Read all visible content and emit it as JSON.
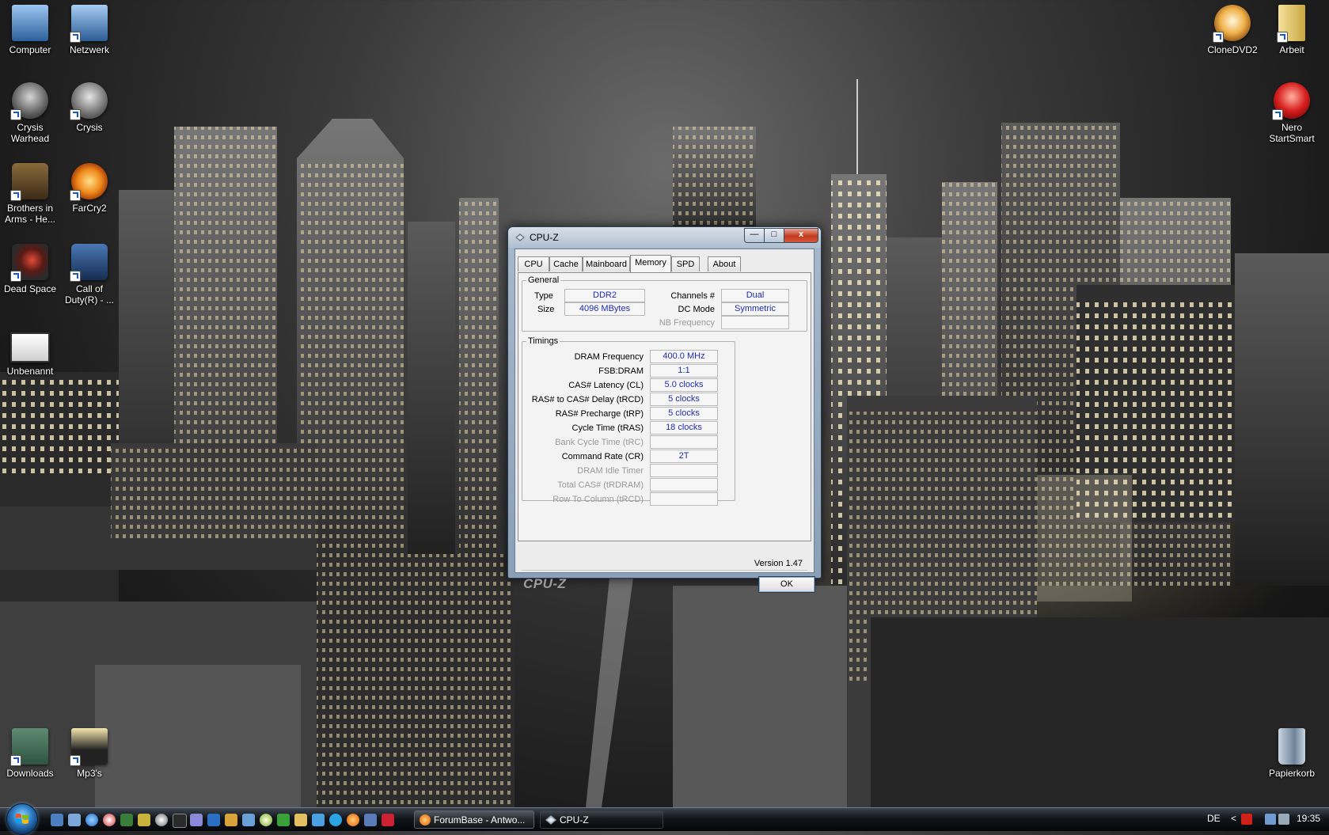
{
  "desktop": {
    "icons_left": [
      {
        "label": "Computer"
      },
      {
        "label": "Netzwerk"
      },
      {
        "label": "Crysis Warhead"
      },
      {
        "label": "Crysis"
      },
      {
        "label": "Brothers in Arms - He..."
      },
      {
        "label": "FarCry2"
      },
      {
        "label": "Dead Space"
      },
      {
        "label": "Call of Duty(R) - ..."
      },
      {
        "label": "Unbenannt"
      },
      {
        "label": "Downloads"
      },
      {
        "label": "Mp3's"
      }
    ],
    "icons_right": [
      {
        "label": "CloneDVD2"
      },
      {
        "label": "Arbeit"
      },
      {
        "label": "Nero StartSmart"
      },
      {
        "label": "Papierkorb"
      }
    ]
  },
  "window": {
    "title": "CPU-Z",
    "controls": {
      "minimize": "—",
      "maximize": "□",
      "close": "x"
    },
    "tabs": [
      {
        "label": "CPU",
        "active": false
      },
      {
        "label": "Cache",
        "active": false
      },
      {
        "label": "Mainboard",
        "active": false
      },
      {
        "label": "Memory",
        "active": true
      },
      {
        "label": "SPD",
        "active": false
      },
      {
        "label": "About",
        "active": false
      }
    ],
    "general": {
      "legend": "General",
      "type_label": "Type",
      "type_value": "DDR2",
      "size_label": "Size",
      "size_value": "4096 MBytes",
      "channels_label": "Channels #",
      "channels_value": "Dual",
      "dcmode_label": "DC Mode",
      "dcmode_value": "Symmetric",
      "nbfreq_label": "NB Frequency",
      "nbfreq_value": ""
    },
    "timings": {
      "legend": "Timings",
      "rows": [
        {
          "label": "DRAM Frequency",
          "value": "400.0 MHz",
          "enabled": true
        },
        {
          "label": "FSB:DRAM",
          "value": "1:1",
          "enabled": true
        },
        {
          "label": "CAS# Latency (CL)",
          "value": "5.0 clocks",
          "enabled": true
        },
        {
          "label": "RAS# to CAS# Delay (tRCD)",
          "value": "5 clocks",
          "enabled": true
        },
        {
          "label": "RAS# Precharge (tRP)",
          "value": "5 clocks",
          "enabled": true
        },
        {
          "label": "Cycle Time (tRAS)",
          "value": "18 clocks",
          "enabled": true
        },
        {
          "label": "Bank Cycle Time (tRC)",
          "value": "",
          "enabled": false
        },
        {
          "label": "Command Rate (CR)",
          "value": "2T",
          "enabled": true
        },
        {
          "label": "DRAM Idle Timer",
          "value": "",
          "enabled": false
        },
        {
          "label": "Total CAS# (tRDRAM)",
          "value": "",
          "enabled": false
        },
        {
          "label": "Row To Column (tRCD)",
          "value": "",
          "enabled": false
        }
      ]
    },
    "version": "Version 1.47",
    "brand": "CPU-Z",
    "ok_label": "OK"
  },
  "taskbar": {
    "buttons": [
      {
        "label": "ForumBase - Antwo...",
        "active": false
      },
      {
        "label": "CPU-Z",
        "active": true
      }
    ],
    "tray": {
      "language": "DE",
      "chevron": "<",
      "clock": "19:35"
    }
  },
  "colors": {
    "value_text": "#1f2bb0",
    "disabled_text": "#9a9a9a",
    "window_frame": "#a7b9cc",
    "taskbar": "#121519"
  }
}
